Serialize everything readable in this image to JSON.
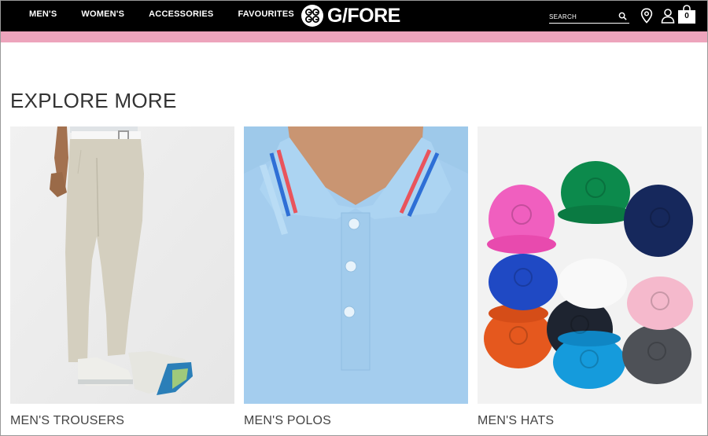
{
  "header": {
    "nav": [
      {
        "label": "MEN'S"
      },
      {
        "label": "WOMEN'S"
      },
      {
        "label": "ACCESSORIES"
      },
      {
        "label": "FAVOURITES"
      }
    ],
    "logo_text": "G/FORE",
    "search_placeholder": "SEARCH",
    "bag_count": "0",
    "strip_color": "#eda4bc"
  },
  "main": {
    "section_title": "EXPLORE MORE",
    "cards": [
      {
        "caption": "MEN'S TROUSERS",
        "image": "mens-trousers-photo"
      },
      {
        "caption": "MEN'S POLOS",
        "image": "mens-polos-photo"
      },
      {
        "caption": "MEN'S HATS",
        "image": "mens-hats-photo"
      }
    ]
  }
}
